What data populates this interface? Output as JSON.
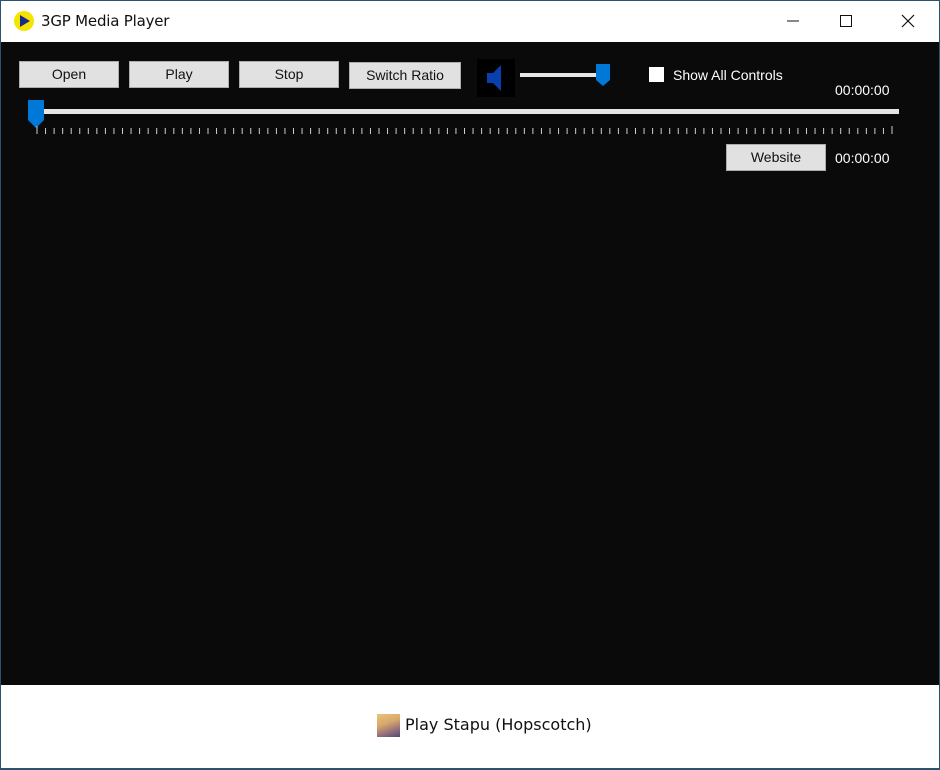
{
  "window": {
    "title": "3GP Media Player",
    "icon": "play-logo-icon",
    "controls": [
      "minimize",
      "maximize",
      "close"
    ]
  },
  "toolbar": {
    "open_label": "Open",
    "play_label": "Play",
    "stop_label": "Stop",
    "switch_ratio_label": "Switch Ratio",
    "website_label": "Website",
    "show_all_controls_label": "Show All Controls",
    "show_all_controls_checked": false
  },
  "volume": {
    "icon": "speaker-icon",
    "level_percent": 100
  },
  "seek": {
    "position_percent": 0,
    "tick_count": 100
  },
  "time": {
    "current": "00:00:00",
    "total": "00:00:00"
  },
  "footer": {
    "link_text": "Play Stapu (Hopscotch)",
    "thumbnail": "game-thumbnail"
  },
  "colors": {
    "accent": "#0078d7",
    "video_bg": "#0a0a0a",
    "speaker": "#0a3fb0"
  }
}
